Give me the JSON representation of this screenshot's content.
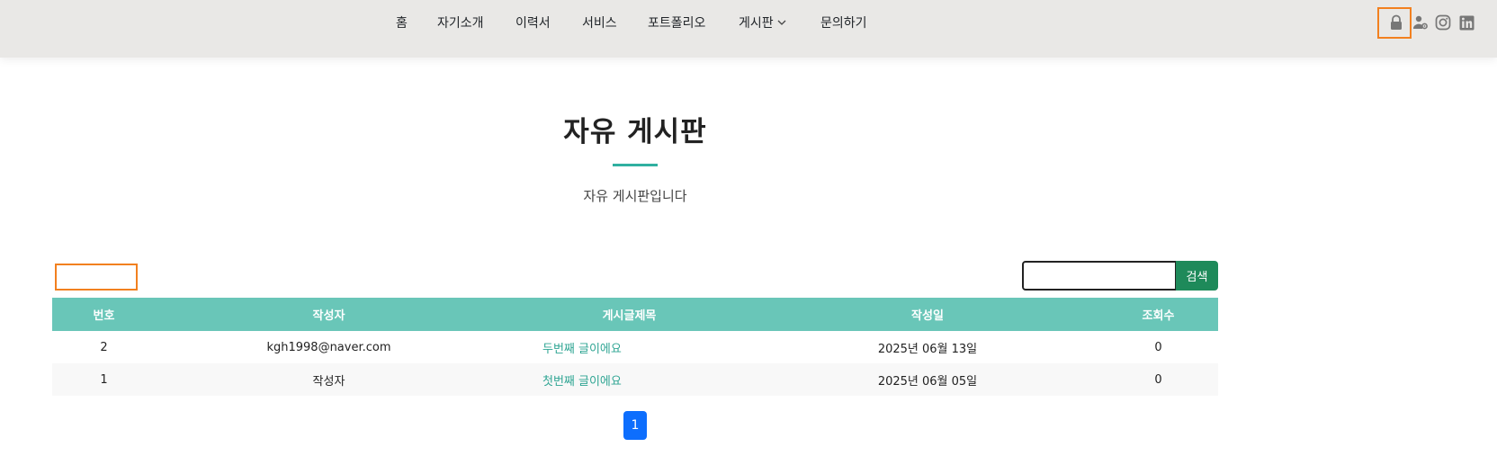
{
  "nav": {
    "items": [
      {
        "label": "홈"
      },
      {
        "label": "자기소개"
      },
      {
        "label": "이력서"
      },
      {
        "label": "서비스"
      },
      {
        "label": "포트폴리오"
      },
      {
        "label": "게시판"
      },
      {
        "label": "문의하기"
      }
    ],
    "dropdown_icon": "chevron-down-icon"
  },
  "header_icons": [
    "lock-icon",
    "user-gear-icon",
    "instagram-icon",
    "linkedin-icon"
  ],
  "page": {
    "title": "자유 게시판",
    "subtitle": "자유 게시판입니다"
  },
  "search": {
    "value": "",
    "button_label": "검색"
  },
  "table": {
    "columns": [
      "번호",
      "작성자",
      "게시글제목",
      "작성일",
      "조회수"
    ],
    "rows": [
      {
        "no": "2",
        "author": "kgh1998@naver.com",
        "title": "두번째 글이에요",
        "date": "2025년 06월 13일",
        "views": "0"
      },
      {
        "no": "1",
        "author": "작성자",
        "title": "첫번째 글이에요",
        "date": "2025년 06월 05일",
        "views": "0"
      }
    ]
  },
  "pagination": {
    "current": "1"
  },
  "colors": {
    "header_bg": "#e9e8e6",
    "accent": "#69c6b8",
    "link": "#2fa593",
    "search_button": "#1e8a5a",
    "page_active": "#0d6efd",
    "highlight": "#f2801f"
  }
}
